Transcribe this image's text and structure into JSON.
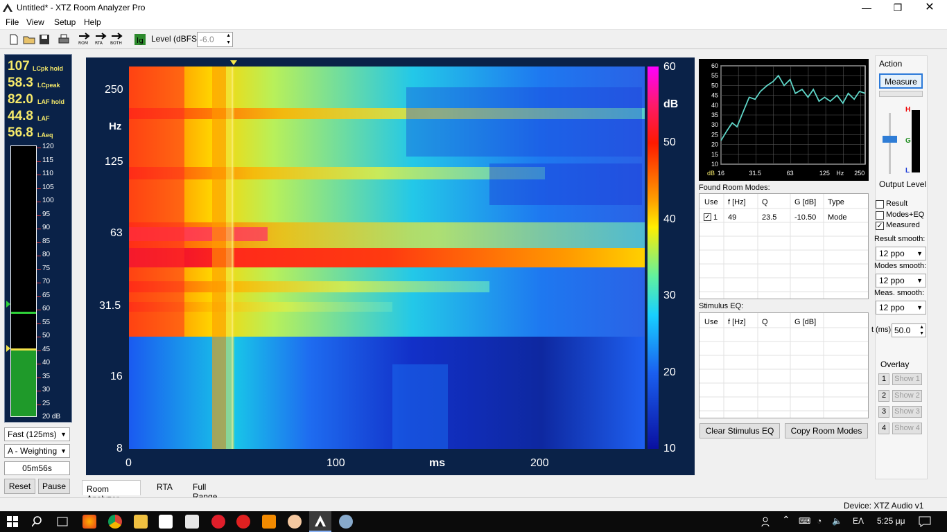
{
  "window": {
    "title": "Untitled* - XTZ Room Analyzer Pro"
  },
  "menu": [
    "File",
    "View",
    "Setup",
    "Help"
  ],
  "toolbar": {
    "level_label": "Level (dBFS)",
    "level_value": "-6.0",
    "rom_label": "ROM",
    "rta_label": "RTA",
    "both_label": "BOTH"
  },
  "meter": {
    "readings": [
      {
        "value": "107",
        "label": "LCpk hold"
      },
      {
        "value": "58.3",
        "label": "LCpeak"
      },
      {
        "value": "82.0",
        "label": "LAF hold"
      },
      {
        "value": "44.8",
        "label": "LAF"
      },
      {
        "value": "56.8",
        "label": "LAeq"
      }
    ],
    "scale": [
      "120",
      "115",
      "110",
      "105",
      "100",
      "95",
      "90",
      "85",
      "80",
      "75",
      "70",
      "65",
      "60",
      "55",
      "50",
      "45",
      "40",
      "35",
      "30",
      "25",
      "20 dB"
    ],
    "hold_level": 58,
    "current_level": 44.5,
    "speed": "Fast (125ms)",
    "weighting": "A - Weighting",
    "elapsed": "05m56s",
    "reset": "Reset",
    "pause": "Pause"
  },
  "plot": {
    "y_ticks": [
      "250",
      "125",
      "63",
      "31.5",
      "16",
      "8"
    ],
    "y_unit": "Hz",
    "x_ticks": [
      "0",
      "100",
      "200"
    ],
    "x_unit": "ms",
    "cbar_ticks": [
      "60",
      "50",
      "40",
      "30",
      "20",
      "10"
    ],
    "cbar_unit": "dB"
  },
  "tabs": [
    "Room Analyzer",
    "RTA",
    "Full Range"
  ],
  "mini_chart": {
    "y_ticks": [
      "60",
      "55",
      "50",
      "45",
      "40",
      "35",
      "30",
      "25",
      "20",
      "15",
      "10"
    ],
    "y_unit": "dB",
    "x_ticks": [
      "16",
      "31.5",
      "63",
      "125",
      "Hz",
      "250"
    ]
  },
  "chart_data": {
    "type": "line",
    "x": [
      16,
      18,
      20,
      22,
      25,
      28,
      31.5,
      35,
      40,
      45,
      50,
      56,
      63,
      70,
      80,
      90,
      100,
      112,
      125,
      140,
      160,
      180,
      200,
      225,
      250,
      280
    ],
    "series": [
      {
        "values": [
          22,
          27,
          31,
          29,
          37,
          44,
          43,
          47,
          50,
          52,
          55,
          50,
          53,
          46,
          48,
          44,
          48,
          42,
          44,
          42,
          45,
          41,
          46,
          43,
          47,
          46
        ]
      }
    ],
    "ylim": [
      10,
      60
    ]
  },
  "action": {
    "title": "Action",
    "measure": "Measure",
    "output_level": "Output Level",
    "letters": [
      "H",
      "G",
      "L"
    ]
  },
  "room_modes": {
    "title": "Found Room Modes:",
    "headers": [
      "Use",
      "f [Hz]",
      "Q",
      "G [dB]",
      "Type"
    ],
    "rows": [
      {
        "use": "1",
        "f": "49",
        "q": "23.5",
        "g": "-10.50",
        "type": "Mode"
      }
    ]
  },
  "stimulus": {
    "title": "Stimulus EQ:",
    "headers": [
      "Use",
      "f [Hz]",
      "Q",
      "G [dB]"
    ]
  },
  "buttons": {
    "clear": "Clear Stimulus EQ",
    "copy": "Copy Room Modes"
  },
  "options": {
    "result": "Result",
    "modes_eq": "Modes+EQ",
    "measured": "Measured",
    "result_smooth_label": "Result smooth:",
    "result_smooth": "12 ppo",
    "modes_smooth_label": "Modes smooth:",
    "modes_smooth": "12 ppo",
    "meas_smooth_label": "Meas. smooth:",
    "meas_smooth": "12 ppo",
    "t_label": "t (ms)",
    "t_value": "50.0"
  },
  "overlay": {
    "title": "Overlay",
    "items": [
      {
        "n": "1",
        "label": "Show 1"
      },
      {
        "n": "2",
        "label": "Show 2"
      },
      {
        "n": "3",
        "label": "Show 3"
      },
      {
        "n": "4",
        "label": "Show 4"
      }
    ]
  },
  "status": {
    "device": "Device: XTZ Audio v1"
  },
  "taskbar": {
    "lang": "ΕΛ",
    "time": "5:25 μμ"
  }
}
